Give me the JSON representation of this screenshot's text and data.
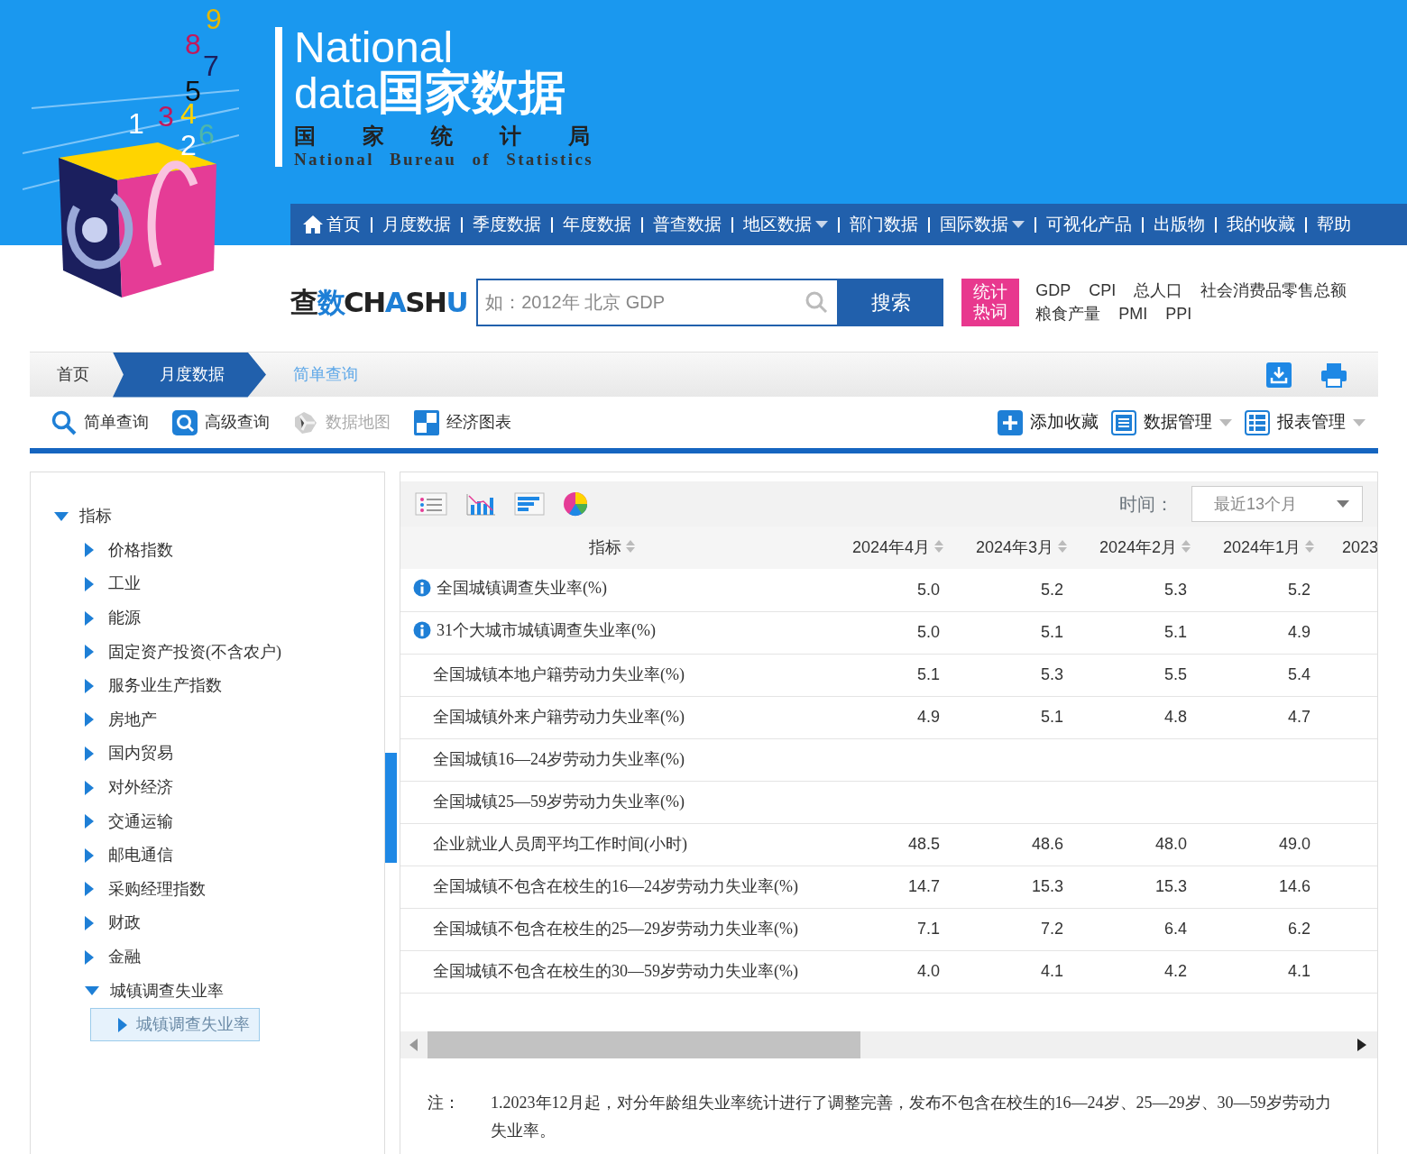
{
  "logo": {
    "digits": [
      "9",
      "8",
      "7",
      "5",
      "1",
      "3",
      "4",
      "2",
      "6"
    ],
    "title_line1": "National",
    "title_latin": "data",
    "title_cn": "国家数据",
    "org_cn": "国家统计局",
    "org_en": "National Bureau of Statistics"
  },
  "nav": [
    {
      "label": "首页",
      "kind": "home",
      "dropdown": false
    },
    {
      "label": "月度数据",
      "kind": "link",
      "dropdown": false
    },
    {
      "label": "季度数据",
      "kind": "link",
      "dropdown": false
    },
    {
      "label": "年度数据",
      "kind": "link",
      "dropdown": false
    },
    {
      "label": "普查数据",
      "kind": "link",
      "dropdown": false
    },
    {
      "label": "地区数据",
      "kind": "link",
      "dropdown": true
    },
    {
      "label": "部门数据",
      "kind": "link",
      "dropdown": false
    },
    {
      "label": "国际数据",
      "kind": "link",
      "dropdown": true
    },
    {
      "label": "可视化产品",
      "kind": "link",
      "dropdown": false
    },
    {
      "label": "出版物",
      "kind": "link",
      "dropdown": false
    },
    {
      "label": "我的收藏",
      "kind": "link",
      "dropdown": false
    },
    {
      "label": "帮助",
      "kind": "link",
      "dropdown": false
    }
  ],
  "search": {
    "brand": [
      {
        "text": "查",
        "color": "#222222"
      },
      {
        "text": "数",
        "color": "#1e7fd6"
      },
      {
        "text": "CH",
        "color": "#222222"
      },
      {
        "text": "A",
        "color": "#1e7fd6"
      },
      {
        "text": "SH",
        "color": "#222222"
      },
      {
        "text": "U",
        "color": "#1e7fd6"
      }
    ],
    "placeholder": "如：2012年 北京 GDP",
    "button": "搜索",
    "hot_label": [
      "统计",
      "热词"
    ],
    "hot_words": [
      "GDP",
      "CPI",
      "总人口",
      "社会消费品零售总额",
      "粮食产量",
      "PMI",
      "PPI"
    ]
  },
  "breadcrumb": [
    {
      "label": "首页",
      "selected": false
    },
    {
      "label": "月度数据",
      "selected": true
    },
    {
      "label": "简单查询",
      "selected": false
    }
  ],
  "tools_left": [
    {
      "label": "简单查询",
      "kind": "search",
      "disabled": false
    },
    {
      "label": "高级查询",
      "kind": "advanced",
      "disabled": false
    },
    {
      "label": "数据地图",
      "kind": "map",
      "disabled": true
    },
    {
      "label": "经济图表",
      "kind": "chart",
      "disabled": false
    }
  ],
  "tools_right": [
    {
      "label": "添加收藏",
      "kind": "add",
      "dropdown": false
    },
    {
      "label": "数据管理",
      "kind": "list",
      "dropdown": true
    },
    {
      "label": "报表管理",
      "kind": "table",
      "dropdown": true
    }
  ],
  "tree": [
    {
      "label": "指标",
      "expanded": true,
      "selected": false,
      "children": [
        {
          "label": "价格指数",
          "expanded": false,
          "selected": false
        },
        {
          "label": "工业",
          "expanded": false,
          "selected": false
        },
        {
          "label": "能源",
          "expanded": false,
          "selected": false
        },
        {
          "label": "固定资产投资(不含农户)",
          "expanded": false,
          "selected": false
        },
        {
          "label": "服务业生产指数",
          "expanded": false,
          "selected": false
        },
        {
          "label": "房地产",
          "expanded": false,
          "selected": false
        },
        {
          "label": "国内贸易",
          "expanded": false,
          "selected": false
        },
        {
          "label": "对外经济",
          "expanded": false,
          "selected": false
        },
        {
          "label": "交通运输",
          "expanded": false,
          "selected": false
        },
        {
          "label": "邮电通信",
          "expanded": false,
          "selected": false
        },
        {
          "label": "采购经理指数",
          "expanded": false,
          "selected": false
        },
        {
          "label": "财政",
          "expanded": false,
          "selected": false
        },
        {
          "label": "金融",
          "expanded": false,
          "selected": false
        },
        {
          "label": "城镇调查失业率",
          "expanded": true,
          "selected": false,
          "children": [
            {
              "label": "城镇调查失业率",
              "expanded": false,
              "selected": true
            }
          ]
        }
      ]
    }
  ],
  "time_filter": {
    "label": "时间：",
    "value": "最近13个月"
  },
  "table": {
    "columns": [
      "指标",
      "2024年4月",
      "2024年3月",
      "2024年2月",
      "2024年1月",
      "2023"
    ],
    "rows": [
      {
        "name": "全国城镇调查失业率(%)",
        "info": true,
        "values": [
          "5.0",
          "5.2",
          "5.3",
          "5.2"
        ]
      },
      {
        "name": "31个大城市城镇调查失业率(%)",
        "info": true,
        "values": [
          "5.0",
          "5.1",
          "5.1",
          "4.9"
        ]
      },
      {
        "name": "全国城镇本地户籍劳动力失业率(%)",
        "info": false,
        "values": [
          "5.1",
          "5.3",
          "5.5",
          "5.4"
        ]
      },
      {
        "name": "全国城镇外来户籍劳动力失业率(%)",
        "info": false,
        "values": [
          "4.9",
          "5.1",
          "4.8",
          "4.7"
        ]
      },
      {
        "name": "全国城镇16—24岁劳动力失业率(%)",
        "info": false
      },
      {
        "name": "全国城镇25—59岁劳动力失业率(%)",
        "info": false
      },
      {
        "name": "企业就业人员周平均工作时间(小时)",
        "info": false,
        "values": [
          "48.5",
          "48.6",
          "48.0",
          "49.0"
        ]
      },
      {
        "name": "全国城镇不包含在校生的16—24岁劳动力失业率(%)",
        "info": false,
        "values": [
          "14.7",
          "15.3",
          "15.3",
          "14.6"
        ]
      },
      {
        "name": "全国城镇不包含在校生的25—29岁劳动力失业率(%)",
        "info": false,
        "values": [
          "7.1",
          "7.2",
          "6.4",
          "6.2"
        ]
      },
      {
        "name": "全国城镇不包含在校生的30—59岁劳动力失业率(%)",
        "info": false,
        "values": [
          "4.0",
          "4.1",
          "4.2",
          "4.1"
        ]
      }
    ]
  },
  "note": {
    "label": "注：",
    "text": "1.2023年12月起，对分年龄组失业率统计进行了调整完善，发布不包含在校生的16—24岁、25—29岁、30—59岁劳动力失业率。"
  }
}
